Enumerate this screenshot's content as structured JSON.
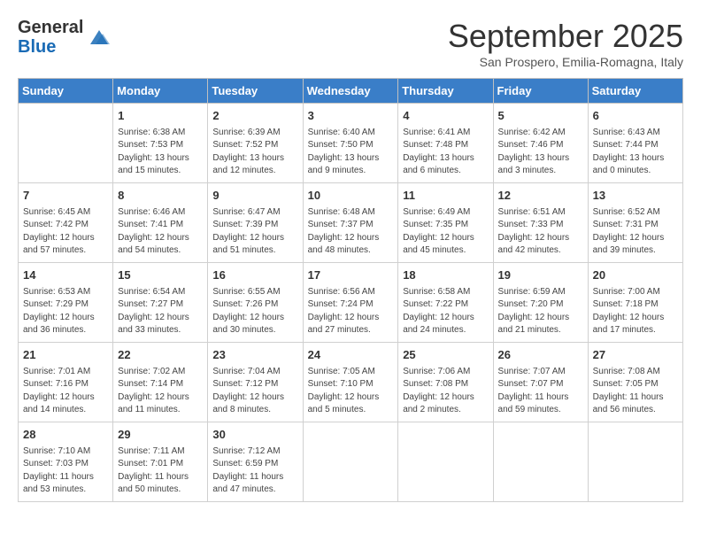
{
  "header": {
    "logo_line1": "General",
    "logo_line2": "Blue",
    "month": "September 2025",
    "location": "San Prospero, Emilia-Romagna, Italy"
  },
  "days_of_week": [
    "Sunday",
    "Monday",
    "Tuesday",
    "Wednesday",
    "Thursday",
    "Friday",
    "Saturday"
  ],
  "weeks": [
    [
      {
        "day": "",
        "sunrise": "",
        "sunset": "",
        "daylight": ""
      },
      {
        "day": "1",
        "sunrise": "Sunrise: 6:38 AM",
        "sunset": "Sunset: 7:53 PM",
        "daylight": "Daylight: 13 hours and 15 minutes."
      },
      {
        "day": "2",
        "sunrise": "Sunrise: 6:39 AM",
        "sunset": "Sunset: 7:52 PM",
        "daylight": "Daylight: 13 hours and 12 minutes."
      },
      {
        "day": "3",
        "sunrise": "Sunrise: 6:40 AM",
        "sunset": "Sunset: 7:50 PM",
        "daylight": "Daylight: 13 hours and 9 minutes."
      },
      {
        "day": "4",
        "sunrise": "Sunrise: 6:41 AM",
        "sunset": "Sunset: 7:48 PM",
        "daylight": "Daylight: 13 hours and 6 minutes."
      },
      {
        "day": "5",
        "sunrise": "Sunrise: 6:42 AM",
        "sunset": "Sunset: 7:46 PM",
        "daylight": "Daylight: 13 hours and 3 minutes."
      },
      {
        "day": "6",
        "sunrise": "Sunrise: 6:43 AM",
        "sunset": "Sunset: 7:44 PM",
        "daylight": "Daylight: 13 hours and 0 minutes."
      }
    ],
    [
      {
        "day": "7",
        "sunrise": "Sunrise: 6:45 AM",
        "sunset": "Sunset: 7:42 PM",
        "daylight": "Daylight: 12 hours and 57 minutes."
      },
      {
        "day": "8",
        "sunrise": "Sunrise: 6:46 AM",
        "sunset": "Sunset: 7:41 PM",
        "daylight": "Daylight: 12 hours and 54 minutes."
      },
      {
        "day": "9",
        "sunrise": "Sunrise: 6:47 AM",
        "sunset": "Sunset: 7:39 PM",
        "daylight": "Daylight: 12 hours and 51 minutes."
      },
      {
        "day": "10",
        "sunrise": "Sunrise: 6:48 AM",
        "sunset": "Sunset: 7:37 PM",
        "daylight": "Daylight: 12 hours and 48 minutes."
      },
      {
        "day": "11",
        "sunrise": "Sunrise: 6:49 AM",
        "sunset": "Sunset: 7:35 PM",
        "daylight": "Daylight: 12 hours and 45 minutes."
      },
      {
        "day": "12",
        "sunrise": "Sunrise: 6:51 AM",
        "sunset": "Sunset: 7:33 PM",
        "daylight": "Daylight: 12 hours and 42 minutes."
      },
      {
        "day": "13",
        "sunrise": "Sunrise: 6:52 AM",
        "sunset": "Sunset: 7:31 PM",
        "daylight": "Daylight: 12 hours and 39 minutes."
      }
    ],
    [
      {
        "day": "14",
        "sunrise": "Sunrise: 6:53 AM",
        "sunset": "Sunset: 7:29 PM",
        "daylight": "Daylight: 12 hours and 36 minutes."
      },
      {
        "day": "15",
        "sunrise": "Sunrise: 6:54 AM",
        "sunset": "Sunset: 7:27 PM",
        "daylight": "Daylight: 12 hours and 33 minutes."
      },
      {
        "day": "16",
        "sunrise": "Sunrise: 6:55 AM",
        "sunset": "Sunset: 7:26 PM",
        "daylight": "Daylight: 12 hours and 30 minutes."
      },
      {
        "day": "17",
        "sunrise": "Sunrise: 6:56 AM",
        "sunset": "Sunset: 7:24 PM",
        "daylight": "Daylight: 12 hours and 27 minutes."
      },
      {
        "day": "18",
        "sunrise": "Sunrise: 6:58 AM",
        "sunset": "Sunset: 7:22 PM",
        "daylight": "Daylight: 12 hours and 24 minutes."
      },
      {
        "day": "19",
        "sunrise": "Sunrise: 6:59 AM",
        "sunset": "Sunset: 7:20 PM",
        "daylight": "Daylight: 12 hours and 21 minutes."
      },
      {
        "day": "20",
        "sunrise": "Sunrise: 7:00 AM",
        "sunset": "Sunset: 7:18 PM",
        "daylight": "Daylight: 12 hours and 17 minutes."
      }
    ],
    [
      {
        "day": "21",
        "sunrise": "Sunrise: 7:01 AM",
        "sunset": "Sunset: 7:16 PM",
        "daylight": "Daylight: 12 hours and 14 minutes."
      },
      {
        "day": "22",
        "sunrise": "Sunrise: 7:02 AM",
        "sunset": "Sunset: 7:14 PM",
        "daylight": "Daylight: 12 hours and 11 minutes."
      },
      {
        "day": "23",
        "sunrise": "Sunrise: 7:04 AM",
        "sunset": "Sunset: 7:12 PM",
        "daylight": "Daylight: 12 hours and 8 minutes."
      },
      {
        "day": "24",
        "sunrise": "Sunrise: 7:05 AM",
        "sunset": "Sunset: 7:10 PM",
        "daylight": "Daylight: 12 hours and 5 minutes."
      },
      {
        "day": "25",
        "sunrise": "Sunrise: 7:06 AM",
        "sunset": "Sunset: 7:08 PM",
        "daylight": "Daylight: 12 hours and 2 minutes."
      },
      {
        "day": "26",
        "sunrise": "Sunrise: 7:07 AM",
        "sunset": "Sunset: 7:07 PM",
        "daylight": "Daylight: 11 hours and 59 minutes."
      },
      {
        "day": "27",
        "sunrise": "Sunrise: 7:08 AM",
        "sunset": "Sunset: 7:05 PM",
        "daylight": "Daylight: 11 hours and 56 minutes."
      }
    ],
    [
      {
        "day": "28",
        "sunrise": "Sunrise: 7:10 AM",
        "sunset": "Sunset: 7:03 PM",
        "daylight": "Daylight: 11 hours and 53 minutes."
      },
      {
        "day": "29",
        "sunrise": "Sunrise: 7:11 AM",
        "sunset": "Sunset: 7:01 PM",
        "daylight": "Daylight: 11 hours and 50 minutes."
      },
      {
        "day": "30",
        "sunrise": "Sunrise: 7:12 AM",
        "sunset": "Sunset: 6:59 PM",
        "daylight": "Daylight: 11 hours and 47 minutes."
      },
      {
        "day": "",
        "sunrise": "",
        "sunset": "",
        "daylight": ""
      },
      {
        "day": "",
        "sunrise": "",
        "sunset": "",
        "daylight": ""
      },
      {
        "day": "",
        "sunrise": "",
        "sunset": "",
        "daylight": ""
      },
      {
        "day": "",
        "sunrise": "",
        "sunset": "",
        "daylight": ""
      }
    ]
  ]
}
